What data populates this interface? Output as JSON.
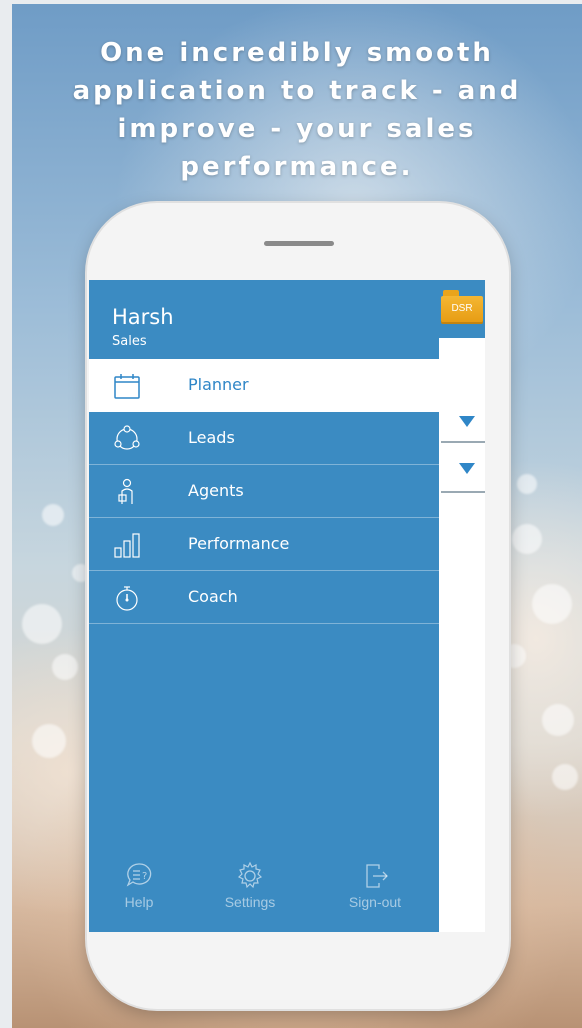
{
  "headline": "One incredibly smooth application to track - and improve - your sales performance.",
  "app_bar": {
    "dsr_label": "DSR"
  },
  "drawer": {
    "user_name": "Harsh",
    "user_role": "Sales",
    "items": [
      {
        "label": "Planner",
        "icon": "calendar-icon",
        "active": true
      },
      {
        "label": "Leads",
        "icon": "leads-network-icon",
        "active": false
      },
      {
        "label": "Agents",
        "icon": "agent-person-icon",
        "active": false
      },
      {
        "label": "Performance",
        "icon": "bar-chart-icon",
        "active": false
      },
      {
        "label": "Coach",
        "icon": "stopwatch-icon",
        "active": false
      }
    ],
    "footer": [
      {
        "label": "Help",
        "icon": "help-chat-icon"
      },
      {
        "label": "Settings",
        "icon": "gear-icon"
      },
      {
        "label": "Sign-out",
        "icon": "sign-out-icon"
      }
    ]
  },
  "colors": {
    "accent": "#3b8bc2",
    "active_text": "#2f86c7",
    "folder": "#f4b733"
  }
}
